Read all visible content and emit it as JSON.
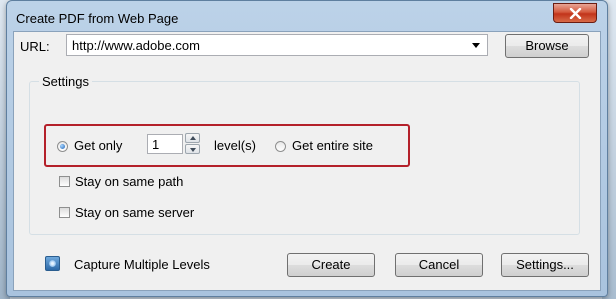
{
  "dialog": {
    "title": "Create PDF from Web Page"
  },
  "url": {
    "label": "URL:",
    "value": "http://www.adobe.com",
    "browse_label": "Browse"
  },
  "settings": {
    "group_label": "Settings",
    "get_only_label": "Get only",
    "get_only_selected": true,
    "levels_value": "1",
    "levels_unit": "level(s)",
    "get_entire_site_label": "Get entire site",
    "get_entire_site_selected": false,
    "stay_same_path_label": "Stay on same path",
    "stay_same_path_checked": false,
    "stay_same_server_label": "Stay on same server",
    "stay_same_server_checked": false
  },
  "footer": {
    "capture_label": "Capture Multiple Levels",
    "create_label": "Create",
    "cancel_label": "Cancel",
    "settings_label": "Settings..."
  },
  "colors": {
    "highlight": "#b4202a",
    "close_button": "#c2341a"
  }
}
